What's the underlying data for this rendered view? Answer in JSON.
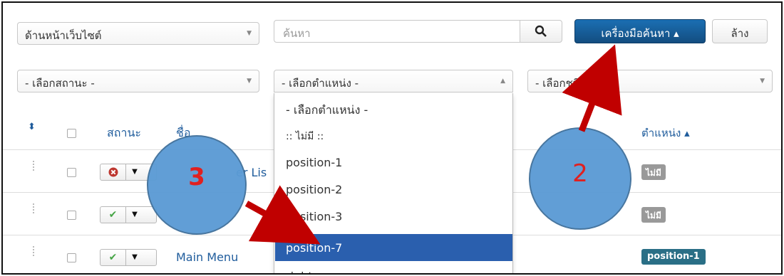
{
  "toolbar": {
    "client_select": "ด้านหน้าเว็บไซต์",
    "search_placeholder": "ค้นหา",
    "search_tools_label": "เครื่องมือค้นหา ▴",
    "clear_label": "ล้าง"
  },
  "filters": {
    "state_select": "- เลือกสถานะ -",
    "position_select": "- เลือกตำแหน่ง -",
    "type_select": "- เลือกชนิด -"
  },
  "position_dropdown": {
    "options": [
      "- เลือกตำแหน่ง -",
      ":: ไม่มี ::",
      "position-1",
      "position-2",
      "position-3",
      "position-7",
      "right"
    ],
    "selected": "position-7"
  },
  "table": {
    "headers": {
      "status": "สถานะ",
      "title": "ชื่อ",
      "position": "ตำแหน่ง ▴"
    },
    "rows": [
      {
        "title_fragment": "er Lis",
        "position_badge": "ไม่มี"
      },
      {
        "title_fragment": "",
        "position_badge": "ไม่มี"
      },
      {
        "title_fragment": "Main Menu",
        "position_badge": "position-1"
      }
    ]
  },
  "annotations": {
    "step2": "2",
    "step3": "3"
  },
  "colors": {
    "primary": "#134d80",
    "selected_option": "#2a5fae",
    "badge_info": "#2a6f86",
    "annotation_circle": "#5b9bd5",
    "arrow": "#c00000"
  }
}
